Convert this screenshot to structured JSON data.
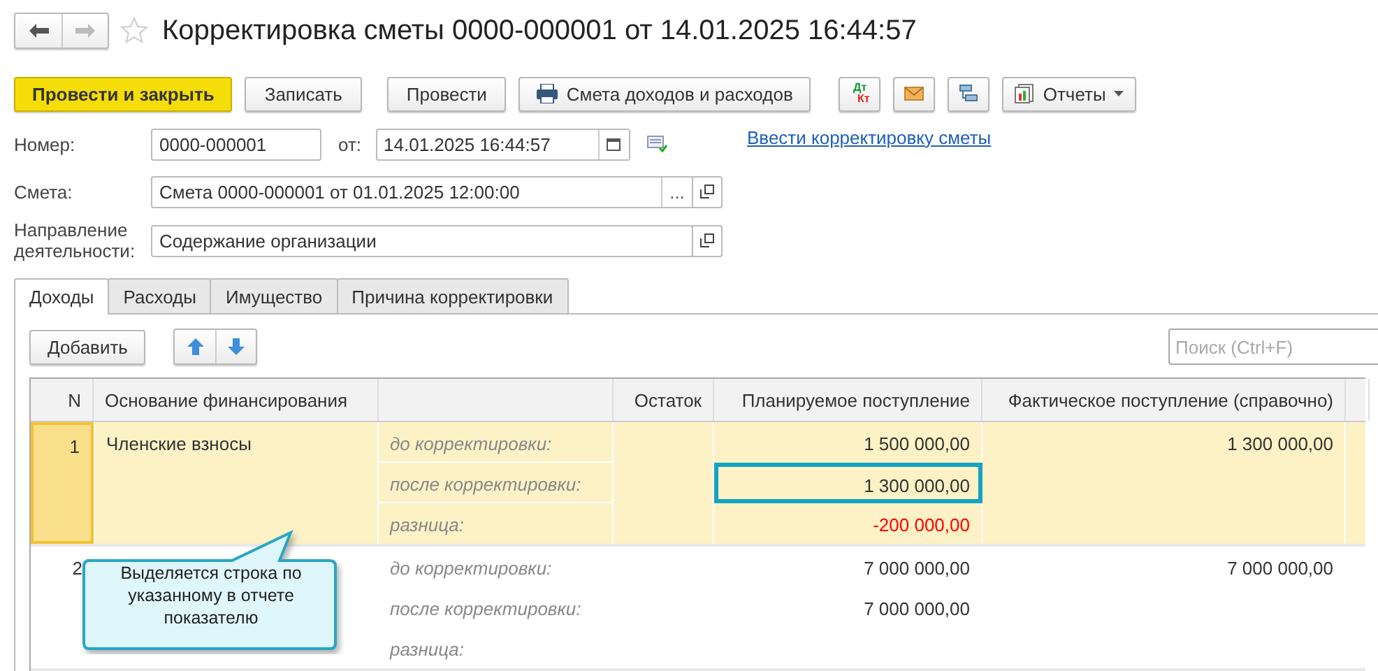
{
  "window": {
    "title": "Корректировка сметы 0000-000001 от 14.01.2025 16:44:57",
    "favorite": false
  },
  "toolbar": {
    "buttons": [
      {
        "kind": "primary",
        "label": "Провести и закрыть"
      },
      {
        "kind": "plain",
        "label": "Записать"
      },
      {
        "kind": "plain",
        "label": "Провести"
      },
      {
        "kind": "print",
        "label": "Смета доходов и расходов"
      }
    ],
    "dtkt": {
      "dt": "Дт",
      "kt": "Кт"
    },
    "reports": "Отчеты"
  },
  "form": {
    "number_label": "Номер:",
    "number": "0000-000001",
    "date_label": "от:",
    "date": "14.01.2025 16:44:57",
    "link": "Ввести корректировку сметы",
    "estimate_label": "Смета:",
    "estimate": "Смета 0000-000001 от 01.01.2025 12:00:00",
    "choose": "...",
    "direction_label": "Направление деятельности:",
    "direction": "Содержание организации"
  },
  "tabs": [
    {
      "label": "Доходы",
      "selected": true
    },
    {
      "label": "Расходы",
      "selected": false
    },
    {
      "label": "Имущество",
      "selected": false
    },
    {
      "label": "Причина корректировки",
      "selected": false
    }
  ],
  "table_toolbar": {
    "add": "Добавить",
    "search": {
      "placeholder": "Поиск (Ctrl+F)"
    }
  },
  "table": {
    "columns": [
      "N",
      "Основание финансирования",
      "Остаток",
      "Планируемое поступление",
      "Фактическое поступление (справочно)"
    ],
    "rows": [
      {
        "n": "1",
        "name": "Членские взносы",
        "selected": true,
        "lines": [
          {
            "label": "до корректировки:",
            "planned": "1 500 000,00",
            "actual": "1 300 000,00",
            "highlighted": false,
            "negative": false
          },
          {
            "label": "после корректировки:",
            "planned": "1 300 000,00",
            "highlighted": true,
            "negative": false
          },
          {
            "label": "разница:",
            "planned": "-200 000,00",
            "highlighted": false,
            "negative": true
          }
        ]
      },
      {
        "n": "2",
        "selected": false,
        "lines": [
          {
            "label": "до корректировки:",
            "planned": "7 000 000,00",
            "actual": "7 000 000,00",
            "highlighted": false,
            "negative": false
          },
          {
            "label": "после корректировки:",
            "planned": "7 000 000,00",
            "highlighted": false,
            "negative": false
          },
          {
            "label": "разница:",
            "highlighted": false
          }
        ]
      }
    ]
  },
  "callout": {
    "text": "Выделяется строка по указанному в отчете показателю"
  }
}
